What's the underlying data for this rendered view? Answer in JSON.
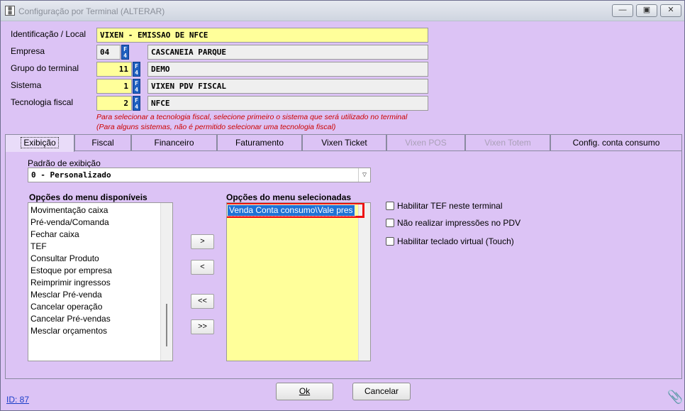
{
  "window": {
    "title": "Configuração por Terminal (ALTERAR)",
    "minimize": "—",
    "maximize": "▣",
    "close": "✕"
  },
  "header": {
    "identificacao": {
      "label": "Identificação / Local",
      "value": "VIXEN - EMISSAO DE NFCE"
    },
    "empresa": {
      "label": "Empresa",
      "code": "04",
      "name": "CASCANEIA PARQUE"
    },
    "grupo": {
      "label": "Grupo do terminal",
      "code": "11",
      "name": "DEMO"
    },
    "sistema": {
      "label": "Sistema",
      "code": "1",
      "name": "VIXEN PDV FISCAL"
    },
    "tecnologia": {
      "label": "Tecnologia fiscal",
      "code": "2",
      "name": "NFCE"
    },
    "f4_label": "F4",
    "note1": "Para selecionar a tecnologia fiscal, selecione primeiro o sistema que será utilizado no terminal",
    "note2": "(Para alguns sistemas, não é permitido selecionar uma tecnologia fiscal)"
  },
  "tabs": [
    {
      "label": "Exibição",
      "active": true,
      "disabled": false
    },
    {
      "label": "Fiscal",
      "active": false,
      "disabled": false
    },
    {
      "label": "Financeiro",
      "active": false,
      "disabled": false
    },
    {
      "label": "Faturamento",
      "active": false,
      "disabled": false
    },
    {
      "label": "Vixen Ticket",
      "active": false,
      "disabled": false
    },
    {
      "label": "Vixen POS",
      "active": false,
      "disabled": true
    },
    {
      "label": "Vixen Totem",
      "active": false,
      "disabled": true
    },
    {
      "label": "Config. conta consumo",
      "active": false,
      "disabled": false
    }
  ],
  "exibicao": {
    "padrao_label": "Padrão de exibição",
    "padrao_value": "0 - Personalizado",
    "disponiveis_label": "Opções do menu disponíveis",
    "disponiveis": [
      "Movimentação caixa",
      "Pré-venda/Comanda",
      "Fechar caixa",
      "TEF",
      "Consultar Produto",
      "Estoque por empresa",
      "Reimprimir ingressos",
      "Mesclar Pré-venda",
      "Cancelar operação",
      "Cancelar Pré-vendas",
      "Mesclar orçamentos"
    ],
    "selecionadas_label": "Opções do menu selecionadas",
    "selecionadas": [
      "Venda Conta consumo\\Vale pres"
    ],
    "btn_add": ">",
    "btn_remove": "<",
    "btn_remove_all": "<<",
    "btn_add_all": ">>",
    "checkboxes": [
      {
        "label": "Habilitar TEF neste terminal",
        "checked": false
      },
      {
        "label": "Não realizar impressões no PDV",
        "checked": false
      },
      {
        "label": "Habilitar teclado virtual (Touch)",
        "checked": false
      }
    ]
  },
  "footer": {
    "ok": "Ok",
    "cancel": "Cancelar",
    "id_label": "ID: 87"
  }
}
